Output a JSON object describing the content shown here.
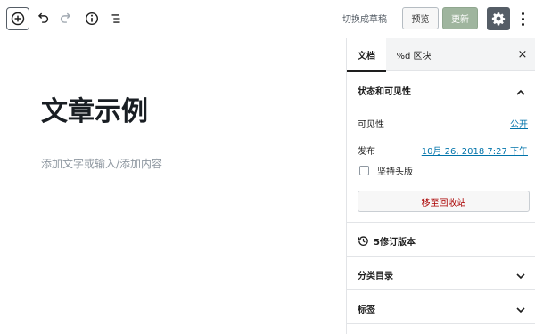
{
  "toolbar": {
    "switch_to_draft": "切换成草稿",
    "preview": "预览",
    "update": "更新",
    "icons": [
      "add-block-icon",
      "undo-icon",
      "redo-icon",
      "info-icon",
      "outline-icon",
      "gear-icon",
      "more-vertical-icon"
    ]
  },
  "editor": {
    "title": "文章示例",
    "placeholder": "添加文字或输入/添加内容"
  },
  "sidebar": {
    "tabs": {
      "document": "文档",
      "block": "%d 区块",
      "close": "×"
    },
    "status": {
      "title": "状态和可见性",
      "visibility_label": "可见性",
      "visibility_value": "公开",
      "publish_label": "发布",
      "publish_value": "10月 26, 2018 7:27 下午",
      "sticky_label": "坚持头版",
      "sticky_checked": false,
      "trash_button": "移至回收站"
    },
    "revisions": "5修订版本",
    "categories": "分类目录",
    "tags": "标签"
  },
  "colors": {
    "link": "#0073aa",
    "update_button": "#9fb59e",
    "settings_button": "#555d66",
    "trash_text": "#aa0000"
  }
}
